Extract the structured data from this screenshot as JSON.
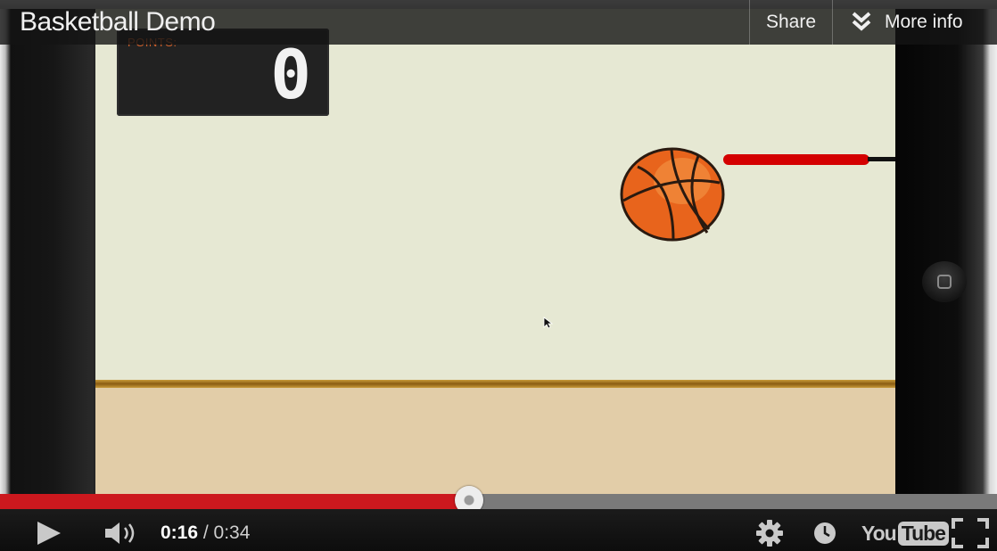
{
  "player": {
    "title": "Basketball Demo",
    "share_label": "Share",
    "more_info_label": "More info",
    "time_current": "0:16",
    "time_separator": " / ",
    "time_total": "0:34",
    "progress_fraction": 0.4706,
    "logo_text_you": "You",
    "logo_text_tube": "Tube"
  },
  "game": {
    "score_label": "POINTS:",
    "score_value": "0"
  },
  "colors": {
    "progress_played": "#cc181e",
    "rim": "#d40000",
    "ball": "#e8641c",
    "court_wall": "#e6e8d3",
    "court_floor": "#e2cda8"
  },
  "icons": {
    "play": "play-icon",
    "volume": "volume-icon",
    "settings": "gear-icon",
    "watch_later": "clock-icon",
    "fullscreen": "fullscreen-icon",
    "more_info": "double-chevron-down-icon",
    "home": "home-button-icon"
  }
}
